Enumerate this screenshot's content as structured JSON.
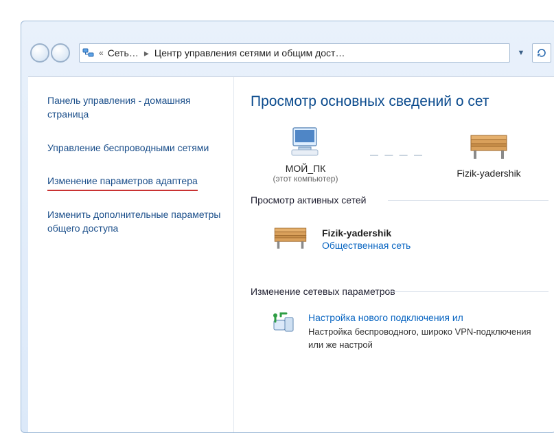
{
  "breadcrumb": {
    "root": "Сеть…",
    "current": "Центр управления сетями и общим дост…"
  },
  "sidebar": {
    "items": [
      {
        "label": "Панель управления - домашняя страница"
      },
      {
        "label": "Управление беспроводными сетями"
      },
      {
        "label": "Изменение параметров адаптера"
      },
      {
        "label": "Изменить дополнительные параметры общего доступа"
      }
    ]
  },
  "main": {
    "heading": "Просмотр основных сведений о сет",
    "active_networks_label": "Просмотр активных сетей",
    "change_settings_label": "Изменение сетевых параметров",
    "map": {
      "computer": {
        "name": "МОЙ_ПК",
        "sub": "(этот компьютер)"
      },
      "network": {
        "name": "Fizik-yadershik"
      }
    },
    "active_net": {
      "name": "Fizik-yadershik",
      "type": "Общественная сеть"
    },
    "new_connection": {
      "title": "Настройка нового подключения ил",
      "desc": "Настройка беспроводного, широко\nVPN-подключения или же настрой"
    }
  }
}
